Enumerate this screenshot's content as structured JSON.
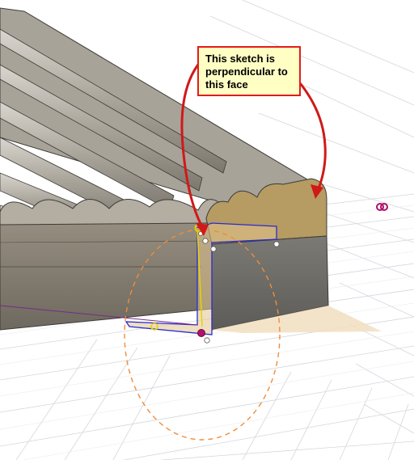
{
  "annotation": {
    "lines": [
      "This sketch is",
      "perpendicular to",
      "this face"
    ]
  },
  "colors": {
    "background": "#ffffff",
    "grid": "#cfd3d9",
    "body_face": "#8c8578",
    "body_dark": "#6f6a62",
    "selected_face": "#b79a5c",
    "sketch_line": "#2b2bd1",
    "sketch_fill": "#e2c58d",
    "dashed_circle": "#f08c3a",
    "callout_border": "#e21c1c",
    "callout_fill": "#ffffc4",
    "arrow": "#d01919",
    "constraint_yellow": "#e5d400",
    "point_magenta": "#b0126b"
  },
  "icons": [
    "sketch-point-icon",
    "origin-marker-icon",
    "coincident-constraint-icon"
  ]
}
